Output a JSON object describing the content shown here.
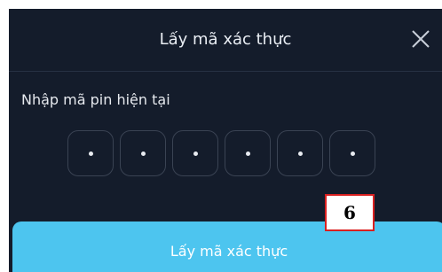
{
  "dialog": {
    "title": "Lấy mã xác thực",
    "close_icon": "close-icon"
  },
  "pin_entry": {
    "label": "Nhập mã pin hiện tại",
    "digits": [
      "•",
      "•",
      "•",
      "•",
      "•",
      "•"
    ]
  },
  "submit_button": {
    "label": "Lấy mã xác thực",
    "color": "#4dc5ef"
  },
  "annotation": {
    "label": "6",
    "border_color": "#d92020"
  },
  "colors": {
    "dialog_bg": "#141c2b",
    "text": "#e9edf3"
  }
}
